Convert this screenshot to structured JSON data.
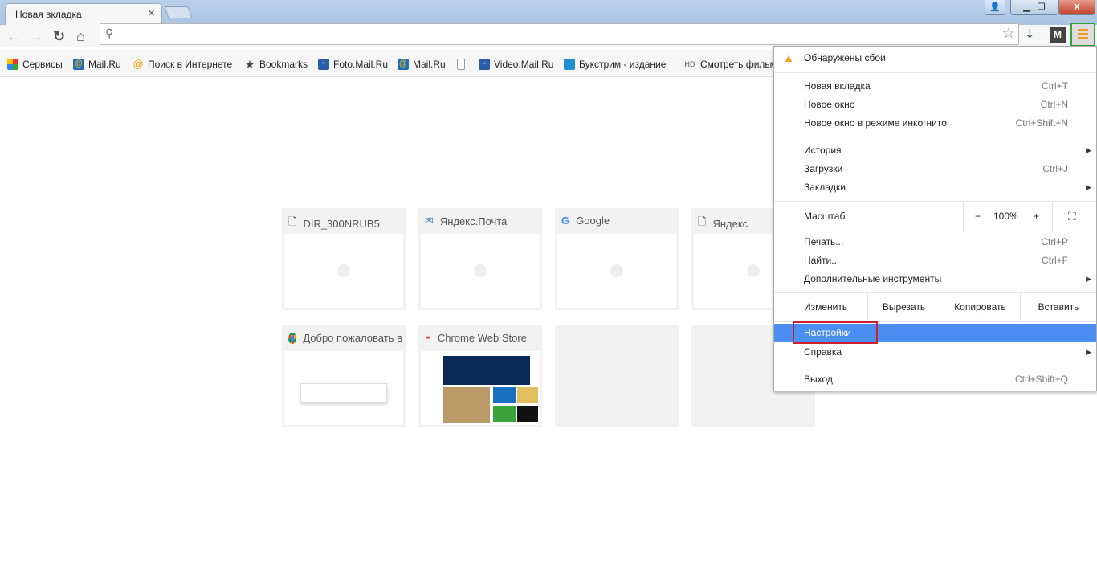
{
  "tab": {
    "title": "Новая вкладка"
  },
  "bookmarks": [
    {
      "label": "Сервисы",
      "icon": "apps-grid-icon"
    },
    {
      "label": "Mail.Ru",
      "icon": "mailru-icon"
    },
    {
      "label": "Поиск в Интернете",
      "icon": "search-mailru-icon"
    },
    {
      "label": "Bookmarks",
      "icon": "star-icon"
    },
    {
      "label": "Foto.Mail.Ru",
      "icon": "foto-icon"
    },
    {
      "label": "Mail.Ru",
      "icon": "mailru-icon"
    },
    {
      "label": "",
      "icon": "page-icon"
    },
    {
      "label": "Video.Mail.Ru",
      "icon": "video-icon"
    },
    {
      "label": "Букстрим - издание",
      "icon": "book-icon"
    },
    {
      "label": "Смотреть фильм",
      "icon": "hd-icon"
    }
  ],
  "tiles": [
    {
      "title": "DIR_300NRUB5",
      "icon": "page-icon"
    },
    {
      "title": "Яндекс.Почта",
      "icon": "mail-icon"
    },
    {
      "title": "Google",
      "icon": "google-icon"
    },
    {
      "title": "Яндекс",
      "icon": "page-icon"
    },
    {
      "title": "Добро пожаловать в",
      "icon": "chrome-icon"
    },
    {
      "title": "Chrome Web Store",
      "icon": "webstore-icon"
    },
    {
      "title": ""
    },
    {
      "title": ""
    }
  ],
  "menu": {
    "crash": "Обнаружены сбои",
    "new_tab": "Новая вкладка",
    "new_tab_sc": "Ctrl+T",
    "new_window": "Новое окно",
    "new_window_sc": "Ctrl+N",
    "incognito": "Новое окно в режиме инкогнито",
    "incognito_sc": "Ctrl+Shift+N",
    "history": "История",
    "downloads": "Загрузки",
    "downloads_sc": "Ctrl+J",
    "bookmarks": "Закладки",
    "zoom": "Масштаб",
    "zoom_minus": "−",
    "zoom_value": "100%",
    "zoom_plus": "+",
    "print": "Печать...",
    "print_sc": "Ctrl+P",
    "find": "Найти...",
    "find_sc": "Ctrl+F",
    "tools": "Дополнительные инструменты",
    "edit": "Изменить",
    "cut": "Вырезать",
    "copy": "Копировать",
    "paste": "Вставить",
    "settings": "Настройки",
    "help": "Справка",
    "exit": "Выход",
    "exit_sc": "Ctrl+Shift+Q"
  },
  "colors": {
    "highlight": "#4a8ef1",
    "settings_outline": "#d0202e",
    "menu_button_outline": "#2fa53c"
  }
}
